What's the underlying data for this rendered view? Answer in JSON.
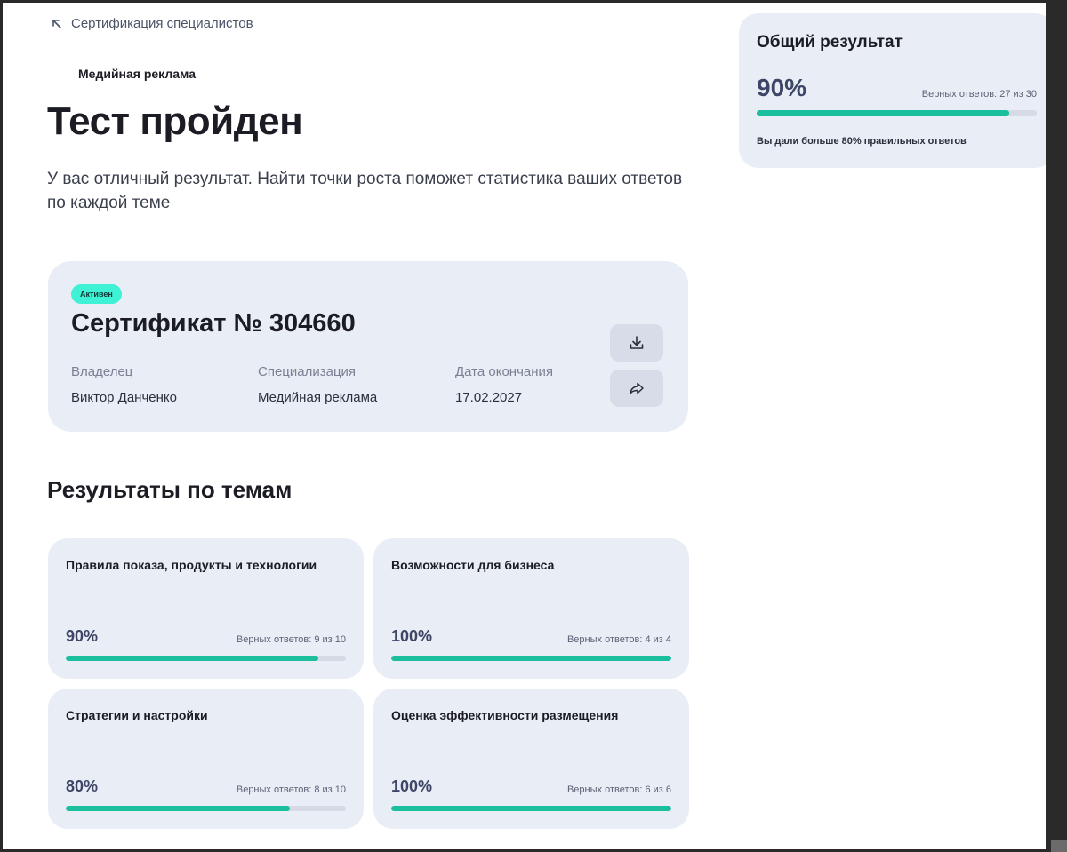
{
  "breadcrumb": {
    "back_label": "Сертификация специалистов",
    "icon": "arrow-up-left-icon"
  },
  "category": "Медийная реклама",
  "title": "Тест пройден",
  "subtitle": "У вас отличный результат. Найти точки роста поможет статистика ваших ответов по каждой теме",
  "certificate": {
    "status": "Активен",
    "title": "Сертификат № 304660",
    "fields": [
      {
        "label": "Владелец",
        "value": "Виктор Данченко"
      },
      {
        "label": "Специализация",
        "value": "Медийная реклама"
      },
      {
        "label": "Дата окончания",
        "value": "17.02.2027"
      }
    ],
    "actions": [
      {
        "name": "download",
        "icon": "download-icon"
      },
      {
        "name": "share",
        "icon": "share-icon"
      }
    ],
    "status_color": "#3ff2d6"
  },
  "topics_section": {
    "title": "Результаты по темам",
    "topics": [
      {
        "name": "Правила показа, продукты и технологии",
        "percent": "90%",
        "correct": "Верных ответов: 9 из 10",
        "fraction": 0.9
      },
      {
        "name": "Возможности для бизнеса",
        "percent": "100%",
        "correct": "Верных ответов: 4 из 4",
        "fraction": 1.0
      },
      {
        "name": "Стратегии и настройки",
        "percent": "80%",
        "correct": "Верных ответов: 8 из 10",
        "fraction": 0.8
      },
      {
        "name": "Оценка эффективности размещения",
        "percent": "100%",
        "correct": "Верных ответов: 6 из 6",
        "fraction": 1.0
      }
    ]
  },
  "overall": {
    "title": "Общий результат",
    "percent": "90%",
    "correct": "Верных ответов: 27 из 30",
    "fraction": 0.9,
    "note": "Вы дали больше 80% правильных ответов"
  },
  "colors": {
    "accent": "#1bbf9e",
    "card_bg": "#e9edf5",
    "badge": "#3ff2d6"
  }
}
